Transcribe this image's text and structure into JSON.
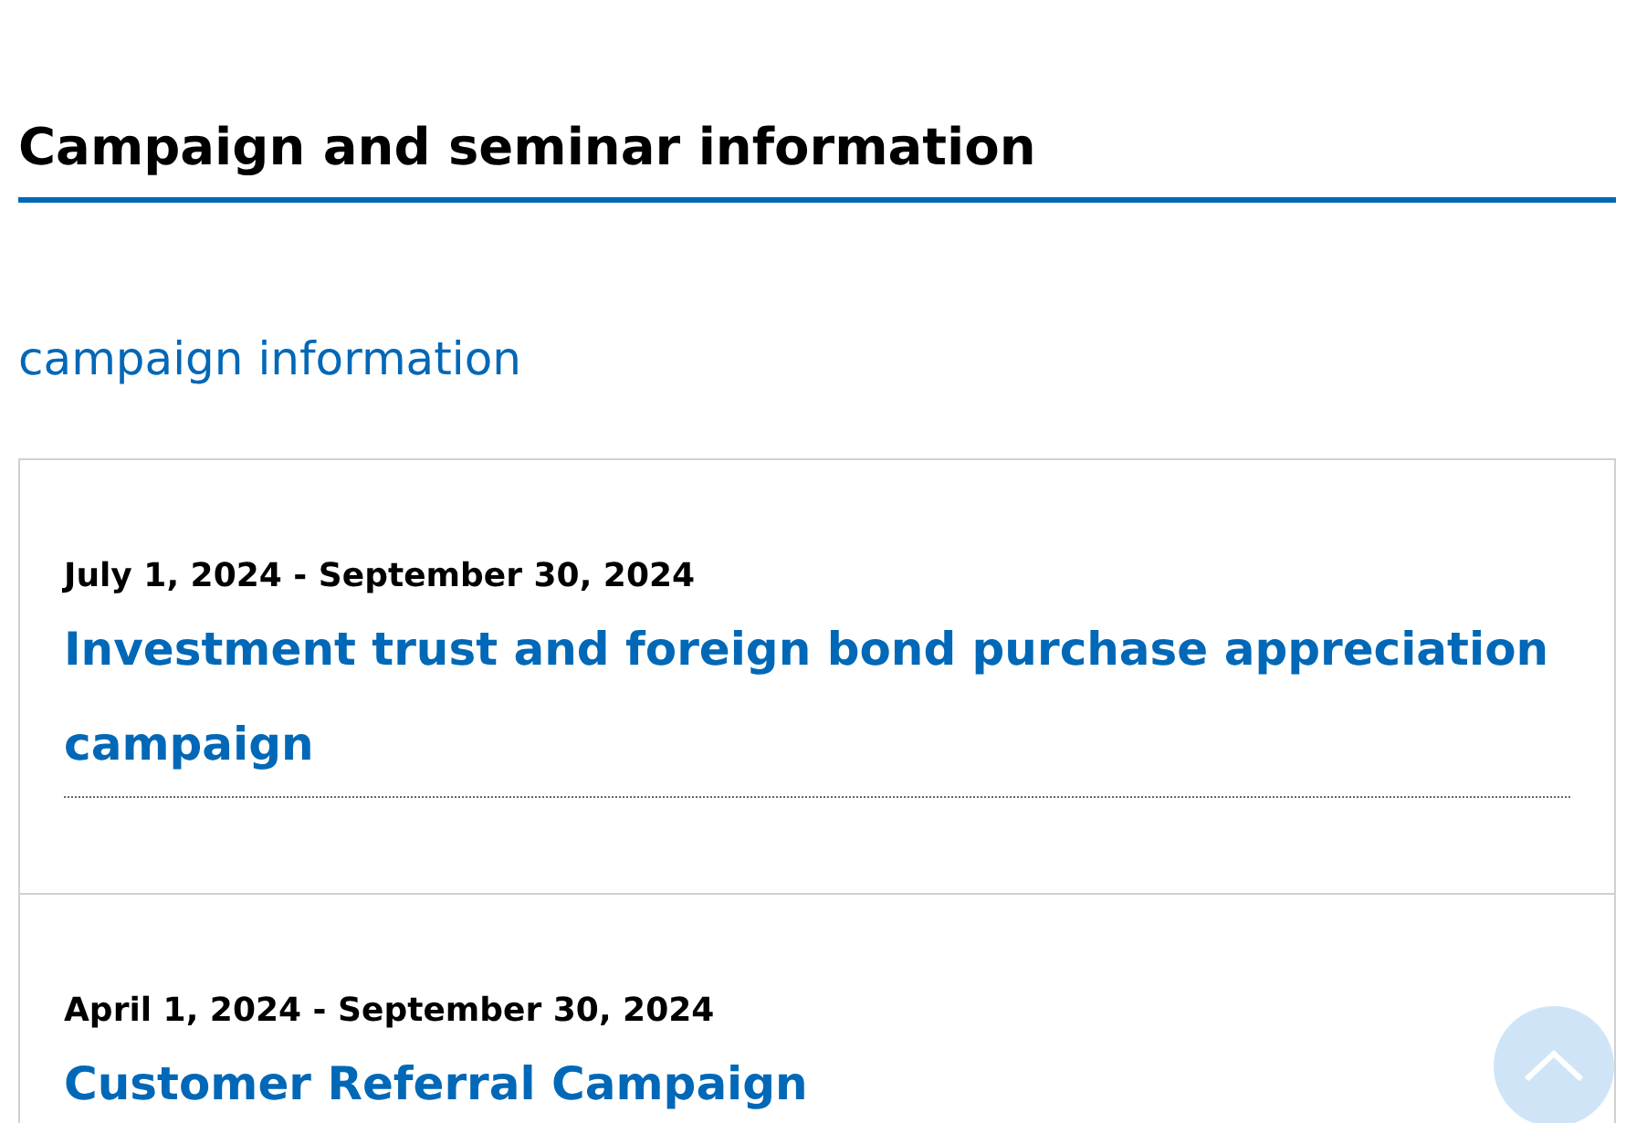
{
  "page_title": "Campaign and seminar information",
  "section_title": "campaign information",
  "campaigns": [
    {
      "period": "July 1, 2024 - September 30, 2024",
      "title": "Investment trust and foreign bond purchase appreciation campaign"
    },
    {
      "period": "April 1, 2024 - September 30, 2024",
      "title": "Customer Referral Campaign"
    }
  ]
}
